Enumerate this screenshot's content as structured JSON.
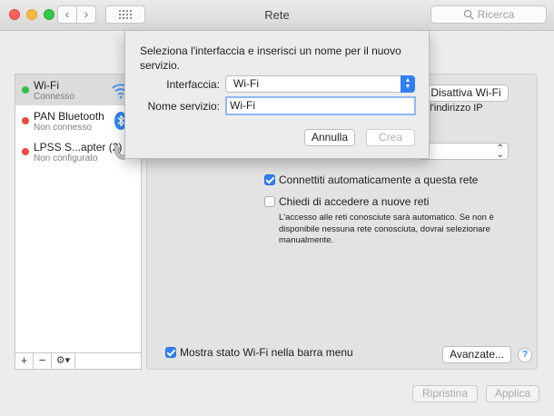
{
  "window": {
    "title": "Rete"
  },
  "search": {
    "placeholder": "Ricerca"
  },
  "sidebar": {
    "items": [
      {
        "name": "Wi-Fi",
        "status": "Connesso",
        "dot": "#2ec244",
        "icon": "wifi-icon"
      },
      {
        "name": "PAN Bluetooth",
        "status": "Non connesso",
        "dot": "#f04a3f",
        "icon": "bluetooth-icon"
      },
      {
        "name": "LPSS S...apter (2)",
        "status": "Non configurato",
        "dot": "#f04a3f",
        "icon": "phone-icon"
      }
    ],
    "add": "+",
    "remove": "−",
    "gear": "⚙▾"
  },
  "pane": {
    "disable_button": "Disattiva Wi-Fi",
    "ip_text": "on l'indirizzo IP",
    "auto_join": {
      "label": "Connettiti automaticamente a questa rete",
      "checked": true
    },
    "ask_join": {
      "label": "Chiedi di accedere a nuove reti",
      "checked": false
    },
    "ask_description": "L'accesso alle reti conosciute sarà automatico. Se non è disponibile nessuna rete conosciuta, dovrai selezionare manualmente.",
    "menu_status": {
      "label": "Mostra stato Wi-Fi nella barra menu",
      "checked": true
    },
    "advanced_button": "Avanzate...",
    "help": "?"
  },
  "footer": {
    "revert": "Ripristina",
    "apply": "Applica"
  },
  "sheet": {
    "prompt": "Seleziona l'interfaccia e inserisci un nome per il nuovo servizio.",
    "interface_label": "Interfaccia:",
    "interface_value": "Wi-Fi",
    "service_label": "Nome servizio:",
    "service_value": "Wi-Fi",
    "cancel": "Annulla",
    "create": "Crea"
  },
  "colors": {
    "accent": "#2f7ff3",
    "connected": "#2ec244",
    "disconnected": "#f04a3f"
  }
}
